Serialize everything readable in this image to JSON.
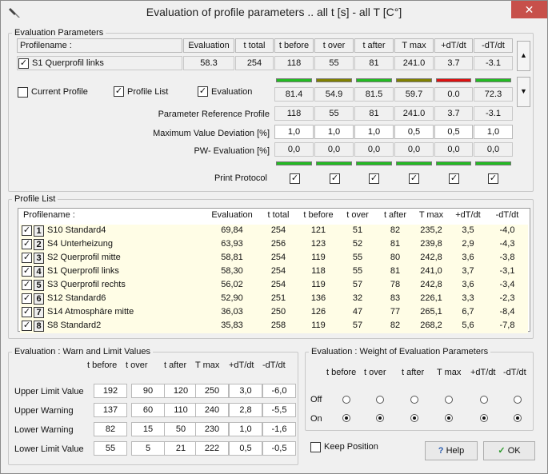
{
  "window": {
    "title": "Evaluation of profile parameters .. all  t [s]  - all T [C°]",
    "close_glyph": "✕"
  },
  "eval_params": {
    "legend": "Evaluation Parameters",
    "headers": [
      "Profilename :",
      "Evaluation",
      "t total",
      "t before",
      "t over",
      "t after",
      "T max",
      "+dT/dt",
      "-dT/dt"
    ],
    "profile": {
      "name": "S1 Querprofil links",
      "evaluation": "58.3",
      "t_total": "254",
      "values": [
        "118",
        "55",
        "81",
        "241.0",
        "3.7",
        "-3.1"
      ]
    },
    "checks": {
      "current_profile": "Current Profile",
      "profile_list": "Profile List",
      "evaluation": "Evaluation"
    },
    "bar_colors": [
      "#22bb22",
      "#808000",
      "#22bb22",
      "#808000",
      "#dd1111",
      "#22bb22"
    ],
    "eval_values": [
      "81.4",
      "54.9",
      "81.5",
      "59.7",
      "0.0",
      "72.3"
    ],
    "ref_label": "Parameter Reference Profile",
    "ref_values": [
      "118",
      "55",
      "81",
      "241.0",
      "3.7",
      "-3.1"
    ],
    "maxdev_label": "Maximum Value Deviation  [%]",
    "maxdev_values": [
      "1,0",
      "1,0",
      "1,0",
      "0,5",
      "0,5",
      "1,0"
    ],
    "pw_label": "PW- Evaluation  [%]",
    "pw_values": [
      "0,0",
      "0,0",
      "0,0",
      "0,0",
      "0,0",
      "0,0"
    ],
    "print_label": "Print Protocol",
    "check_glyph": "✓"
  },
  "profile_list": {
    "legend": "Profile List",
    "headers": [
      "Profilename :",
      "Evaluation",
      "t total",
      "t before",
      "t over",
      "t after",
      "T max",
      "+dT/dt",
      "-dT/dt"
    ],
    "rows": [
      {
        "n": "1",
        "name": "S10 Standard4",
        "eval": "69,84",
        "total": "254",
        "before": "121",
        "over": "51",
        "after": "82",
        "tmax": "235,2",
        "pdt": "3,5",
        "ndt": "-4,0"
      },
      {
        "n": "2",
        "name": "S4 Unterheizung",
        "eval": "63,93",
        "total": "256",
        "before": "123",
        "over": "52",
        "after": "81",
        "tmax": "239,8",
        "pdt": "2,9",
        "ndt": "-4,3"
      },
      {
        "n": "3",
        "name": "S2 Querprofil mitte",
        "eval": "58,81",
        "total": "254",
        "before": "119",
        "over": "55",
        "after": "80",
        "tmax": "242,8",
        "pdt": "3,6",
        "ndt": "-3,8"
      },
      {
        "n": "4",
        "name": "S1 Querprofil links",
        "eval": "58,30",
        "total": "254",
        "before": "118",
        "over": "55",
        "after": "81",
        "tmax": "241,0",
        "pdt": "3,7",
        "ndt": "-3,1"
      },
      {
        "n": "5",
        "name": "S3 Querprofil rechts",
        "eval": "56,02",
        "total": "254",
        "before": "119",
        "over": "57",
        "after": "78",
        "tmax": "242,8",
        "pdt": "3,6",
        "ndt": "-3,4"
      },
      {
        "n": "6",
        "name": "S12 Standard6",
        "eval": "52,90",
        "total": "251",
        "before": "136",
        "over": "32",
        "after": "83",
        "tmax": "226,1",
        "pdt": "3,3",
        "ndt": "-2,3"
      },
      {
        "n": "7",
        "name": "S14 Atmosphäre mitte",
        "eval": "36,03",
        "total": "250",
        "before": "126",
        "over": "47",
        "after": "77",
        "tmax": "265,1",
        "pdt": "6,7",
        "ndt": "-8,4"
      },
      {
        "n": "8",
        "name": "S8 Standard2",
        "eval": "35,83",
        "total": "258",
        "before": "119",
        "over": "57",
        "after": "82",
        "tmax": "268,2",
        "pdt": "5,6",
        "ndt": "-7,8"
      }
    ]
  },
  "warn": {
    "legend": "Evaluation : Warn and Limit Values",
    "headers": [
      "t before",
      "t over",
      "t after",
      "T max",
      "+dT/dt",
      "-dT/dt"
    ],
    "rows": [
      {
        "label": "Upper Limit Value",
        "values": [
          "192",
          "90",
          "120",
          "250",
          "3,0",
          "-6,0"
        ]
      },
      {
        "label": "Upper Warning",
        "values": [
          "137",
          "60",
          "110",
          "240",
          "2,8",
          "-5,5"
        ]
      },
      {
        "label": "Lower Warning",
        "values": [
          "82",
          "15",
          "50",
          "230",
          "1,0",
          "-1,6"
        ]
      },
      {
        "label": "Lower Limit Value",
        "values": [
          "55",
          "5",
          "21",
          "222",
          "0,5",
          "-0,5"
        ]
      }
    ]
  },
  "weight": {
    "legend": "Evaluation : Weight of Evaluation Parameters",
    "headers": [
      "t before",
      "t over",
      "t after",
      "T max",
      "+dT/dt",
      "-dT/dt"
    ],
    "off_label": "Off",
    "on_label": "On"
  },
  "footer": {
    "keep_position": "Keep Position",
    "help": "Help",
    "ok": "OK"
  }
}
